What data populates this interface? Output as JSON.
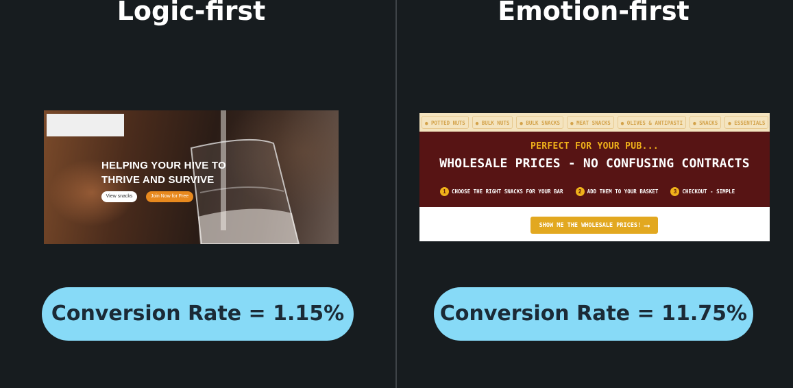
{
  "titles": {
    "left": "Logic-first",
    "right": "Emotion-first"
  },
  "left_mockup": {
    "headline": "HELPING YOUR HIVE TO\nTHRIVE AND SURVIVE",
    "view_button": "View snacks",
    "join_button": "Join Now for Free",
    "accent_color": "#e8891e"
  },
  "right_mockup": {
    "nav_items": [
      "● POTTED NUTS",
      "● BULK NUTS",
      "● BULK SNACKS",
      "● MEAT SNACKS",
      "● OLIVES & ANTIPASTI",
      "● SNACKS",
      "● ESSENTIALS"
    ],
    "subheading": "PERFECT FOR YOUR PUB...",
    "heading": "WHOLESALE PRICES - NO CONFUSING CONTRACTS",
    "steps": [
      {
        "num": "1",
        "text": "CHOOSE THE RIGHT SNACKS FOR YOUR BAR"
      },
      {
        "num": "2",
        "text": "ADD THEM TO YOUR BASKET"
      },
      {
        "num": "3",
        "text": "CHECKOUT - SIMPLE"
      }
    ],
    "cta": "SHOW ME THE WHOLESALE PRICES!",
    "cta_arrow": "⟶",
    "band_color": "#571414",
    "accent_color": "#f0b21a"
  },
  "rates": {
    "left": "Conversion Rate = 1.15%",
    "right": "Conversion Rate = 11.75%"
  }
}
